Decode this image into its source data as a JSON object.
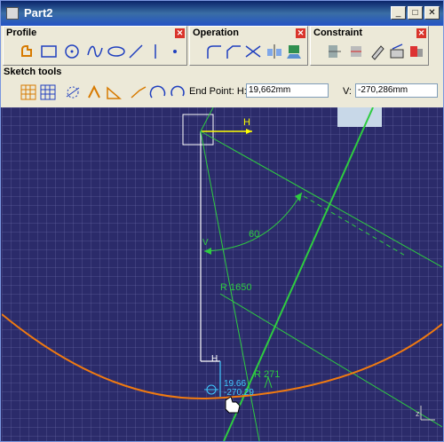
{
  "window": {
    "title": "Part2",
    "minimize_glyph": "_",
    "maximize_glyph": "□",
    "close_glyph": "✕"
  },
  "toolbars": {
    "profile": {
      "label": "Profile"
    },
    "operation": {
      "label": "Operation"
    },
    "constraint": {
      "label": "Constraint"
    },
    "close_glyph": "✕"
  },
  "sketch_tools": {
    "label": "Sketch tools",
    "end_point_label": "End Point: H:",
    "h_value": "19,662mm",
    "v_label": "V:",
    "v_value": "-270,286mm"
  },
  "canvas": {
    "h_axis_label": "H",
    "v_axis_label": "V",
    "angle_label": "60",
    "radius_large_label": "R 1650",
    "radius_small_label": "R 271",
    "cursor_h": "19.66",
    "cursor_v": "-270.29",
    "h_constraint_label": "H",
    "z_axis_label": "z"
  },
  "colors": {
    "canvas_bg": "#2b2b6a",
    "construction_green": "#2ecc40",
    "arc_orange": "#f07a10",
    "sketch_white": "#ffffff",
    "axis_yellow": "#ffff00",
    "dimension_cyan": "#40c8ff"
  }
}
